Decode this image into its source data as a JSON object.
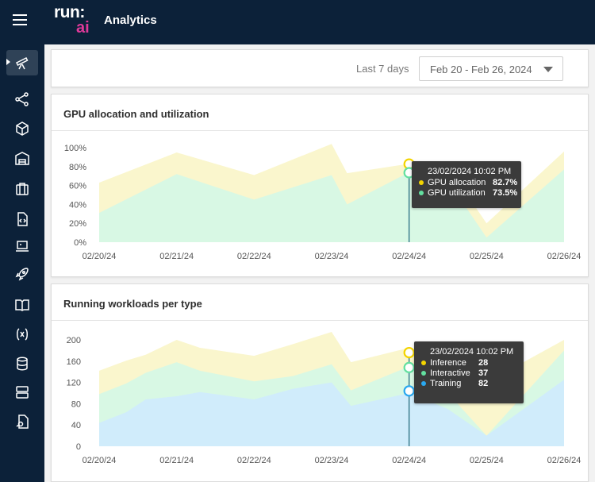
{
  "header": {
    "title": "Analytics",
    "logo_top": "run:",
    "logo_bottom": "ai"
  },
  "sidebar": {
    "items": [
      {
        "name": "analytics",
        "icon": "telescope-icon",
        "active": true
      },
      {
        "name": "flow",
        "icon": "graph-nodes-icon"
      },
      {
        "name": "projects",
        "icon": "cube-icon"
      },
      {
        "name": "departments",
        "icon": "building-icon"
      },
      {
        "name": "workloads",
        "icon": "briefcase-icon"
      },
      {
        "name": "templates",
        "icon": "code-file-icon"
      },
      {
        "name": "environments",
        "icon": "laptop-icon"
      },
      {
        "name": "deployments",
        "icon": "rocket-icon"
      },
      {
        "name": "docs",
        "icon": "book-icon"
      },
      {
        "name": "variables",
        "icon": "function-x-icon"
      },
      {
        "name": "data-sources",
        "icon": "database-icon"
      },
      {
        "name": "nodes",
        "icon": "server-icon"
      },
      {
        "name": "credentials",
        "icon": "file-key-icon"
      }
    ]
  },
  "filter": {
    "label": "Last 7 days",
    "range": "Feb 20 - Feb 26, 2024"
  },
  "chart_data": [
    {
      "type": "area",
      "title": "GPU allocation and utilization",
      "categories": [
        "02/20/24",
        "02/21/24",
        "02/22/24",
        "02/23/24",
        "02/24/24",
        "02/25/24",
        "02/26/24"
      ],
      "y_ticks": [
        "100%",
        "80%",
        "60%",
        "40%",
        "20%",
        "0%"
      ],
      "ylim": [
        0,
        100
      ],
      "x": [
        0,
        1,
        2,
        3,
        3.2,
        4,
        4.6,
        5,
        6
      ],
      "series": [
        {
          "name": "GPU allocation",
          "color": "#faf6cd",
          "values": [
            63,
            95,
            71,
            104,
            73,
            83,
            68,
            20,
            96
          ]
        },
        {
          "name": "GPU utilization",
          "color": "#d8f8e4",
          "values": [
            31,
            72,
            45,
            71,
            40,
            74,
            53,
            5,
            77
          ]
        }
      ],
      "tooltip": {
        "title": "23/02/2024 10:02 PM",
        "rows": [
          {
            "label": "GPU allocation",
            "value": "82.7%",
            "color": "#f3d400"
          },
          {
            "label": "GPU utilization",
            "value": "73.5%",
            "color": "#63e0a0"
          }
        ]
      },
      "marker_x": 4,
      "marker_values": [
        82.7,
        73.5
      ],
      "grid": false,
      "legend": "none"
    },
    {
      "type": "area",
      "title": "Running workloads per type",
      "categories": [
        "02/20/24",
        "02/21/24",
        "02/22/24",
        "02/23/24",
        "02/24/24",
        "02/25/24",
        "02/26/24"
      ],
      "y_ticks": [
        "200",
        "160",
        "120",
        "80",
        "40",
        "0"
      ],
      "ylim": [
        0,
        200
      ],
      "x": [
        0,
        0.35,
        0.6,
        1,
        1.3,
        2,
        2.5,
        3,
        3.25,
        4,
        4.5,
        5,
        6
      ],
      "series": [
        {
          "name": "Inference",
          "color": "#faf6cd",
          "values": [
            142,
            161,
            172,
            200,
            185,
            170,
            192,
            218,
            158,
            185,
            160,
            120,
            200
          ]
        },
        {
          "name": "Interactive",
          "color": "#d8f8e4",
          "values": [
            98,
            118,
            138,
            158,
            142,
            122,
            132,
            154,
            105,
            150,
            100,
            20,
            180
          ]
        },
        {
          "name": "Training",
          "color": "#d0ecfb",
          "values": [
            44,
            64,
            88,
            94,
            102,
            88,
            108,
            120,
            76,
            100,
            70,
            20,
            125
          ]
        }
      ],
      "tooltip": {
        "title": "23/02/2024 10:02 PM",
        "rows": [
          {
            "label": "Inference",
            "value": "28",
            "color": "#f3d400"
          },
          {
            "label": "Interactive",
            "value": "37",
            "color": "#63e0a0"
          },
          {
            "label": "Training",
            "value": "82",
            "color": "#2aa8f0"
          }
        ]
      },
      "marker_x": 4,
      "marker_values": [
        176,
        148,
        104
      ],
      "grid": false,
      "legend": "none"
    }
  ]
}
